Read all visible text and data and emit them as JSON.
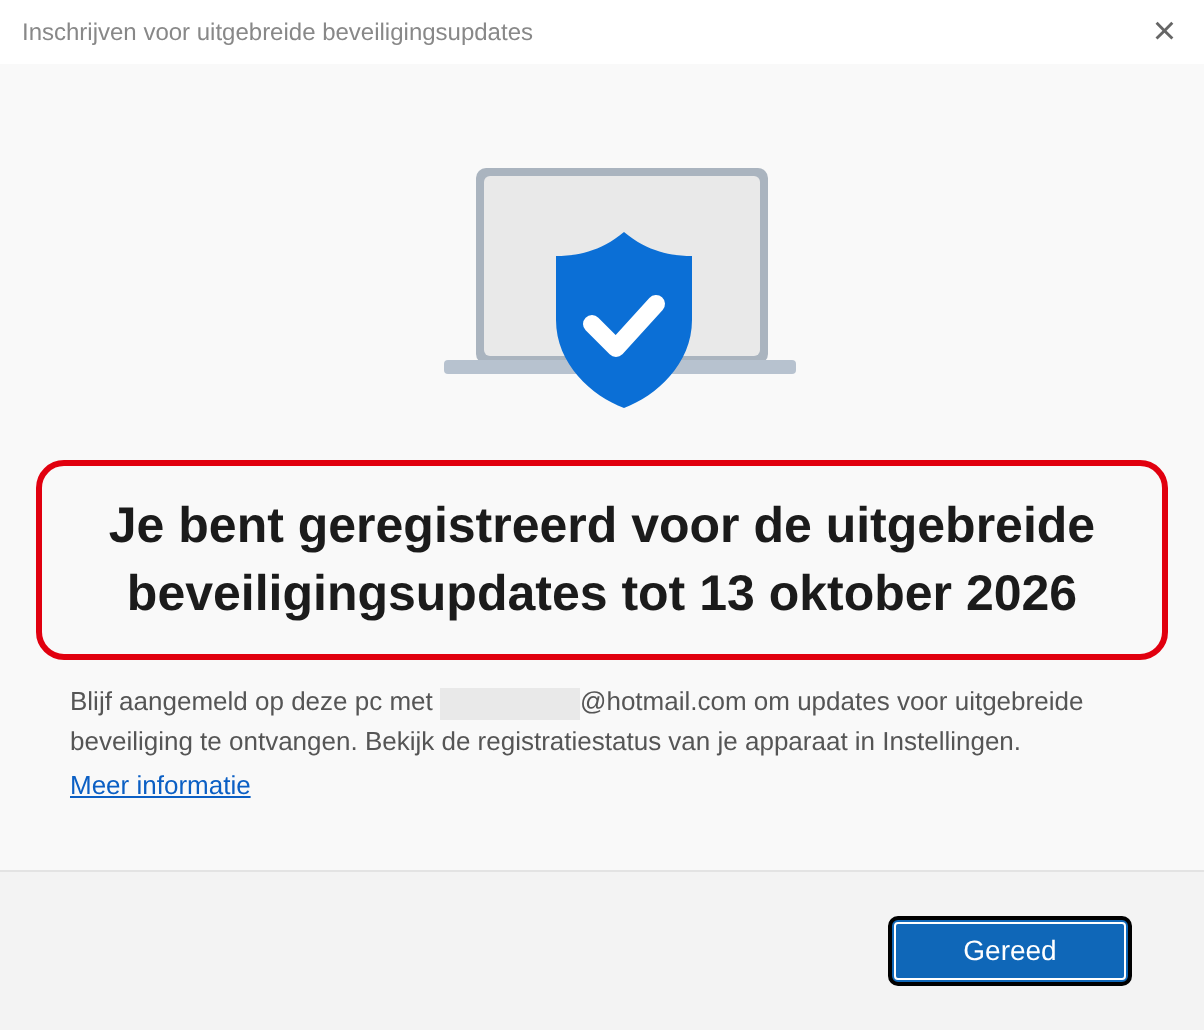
{
  "window": {
    "title": "Inschrijven voor uitgebreide beveiligingsupdates",
    "close": "×"
  },
  "heading": {
    "text": "Je bent geregistreerd voor de uitgebreide beveiligingsupdates tot 13 oktober 2026",
    "highlighted": true
  },
  "body": {
    "before": "Blijf aangemeld op deze pc met",
    "after": "@hotmail.com om updates voor uitgebreide beveiliging te ontvangen. Bekijk de registratiestatus van je apparaat in Instellingen."
  },
  "link": "Meer informatie",
  "buttons": [
    {
      "label": "Gereed",
      "kind": "primary"
    }
  ]
}
